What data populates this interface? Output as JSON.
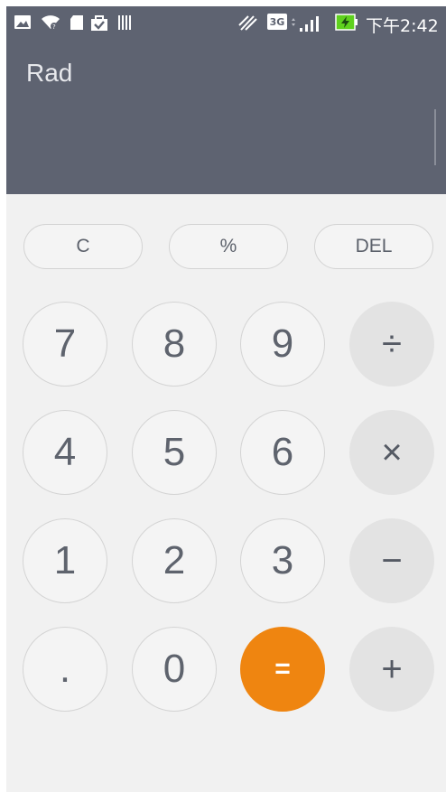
{
  "status_bar": {
    "time": "下午2:42",
    "network": "3G",
    "icons": [
      "image-icon",
      "wifi-icon",
      "sd-card-icon",
      "shopping-bag-icon",
      "barcode-icon",
      "mute-icon",
      "network-type-icon",
      "signal-icon",
      "battery-charging-icon"
    ]
  },
  "display": {
    "mode": "Rad",
    "expression": ""
  },
  "function_row": {
    "clear": "C",
    "percent": "%",
    "delete": "DEL"
  },
  "keypad": {
    "seven": "7",
    "eight": "8",
    "nine": "9",
    "divide": "÷",
    "four": "4",
    "five": "5",
    "six": "6",
    "multiply": "×",
    "one": "1",
    "two": "2",
    "three": "3",
    "subtract": "−",
    "decimal": ".",
    "zero": "0",
    "equals": "=",
    "add": "+"
  },
  "colors": {
    "display_bg": "#5e6371",
    "keypad_bg": "#f1f1f1",
    "equals_accent": "#ef8510",
    "operator_bg": "#e3e3e3"
  }
}
